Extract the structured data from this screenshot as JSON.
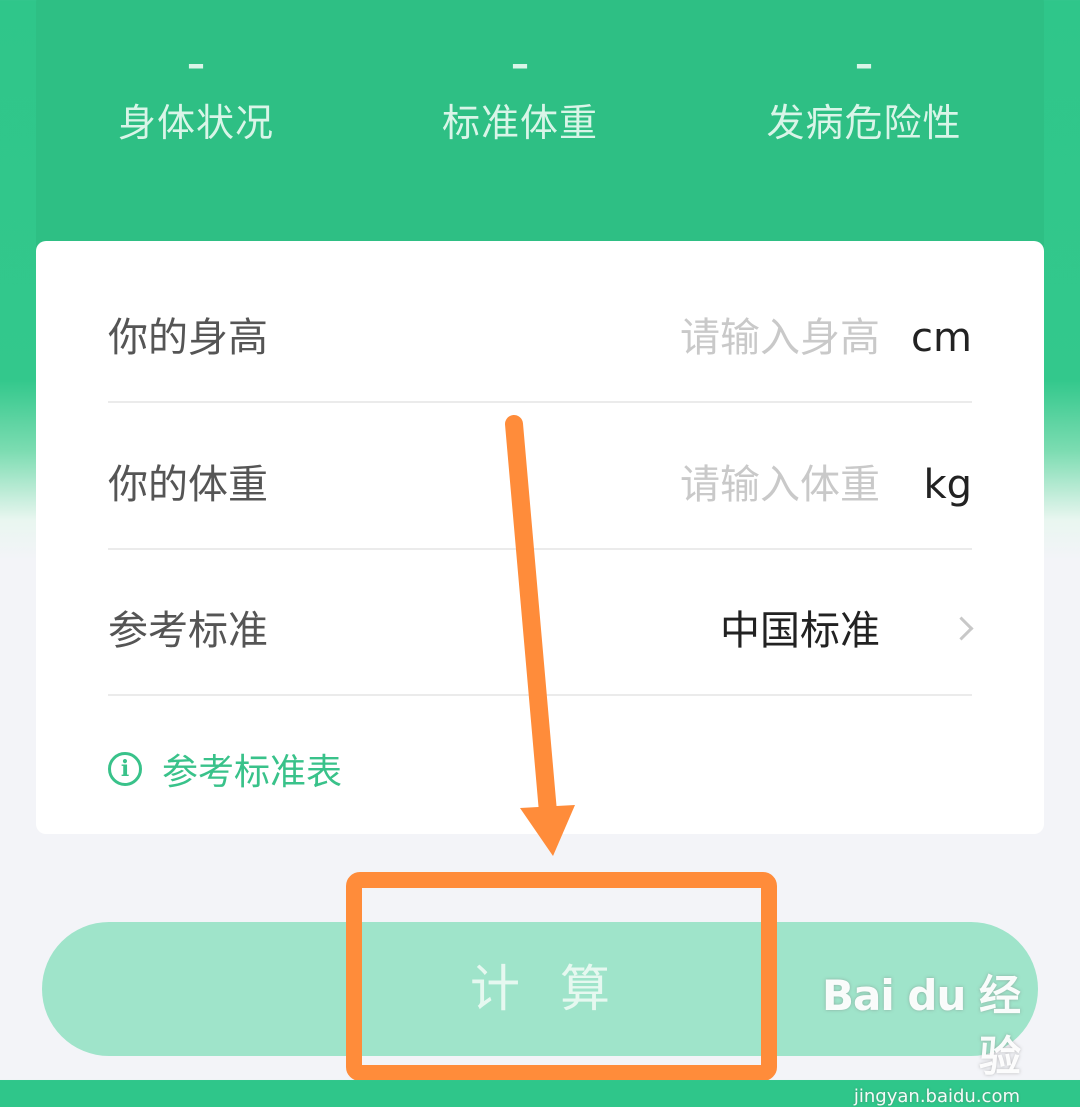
{
  "summary": {
    "stats": [
      {
        "value": "–",
        "label": "身体状况"
      },
      {
        "value": "–",
        "label": "标准体重"
      },
      {
        "value": "–",
        "label": "发病危险性"
      }
    ]
  },
  "form": {
    "height": {
      "label": "你的身高",
      "placeholder": "请输入身高",
      "unit": "cm"
    },
    "weight": {
      "label": "你的体重",
      "placeholder": "请输入体重",
      "unit": "kg"
    },
    "standard": {
      "label": "参考标准",
      "value": "中国标准"
    },
    "ref_link": "参考标准表"
  },
  "action": {
    "calculate_label": "计算"
  },
  "watermark": {
    "logo_text": "Bai du 经验",
    "url": "jingyan.baidu.com"
  },
  "colors": {
    "brand_green": "#2ebf84",
    "link_green": "#39c28a",
    "button_disabled": "#9fe4ca",
    "annotation_orange": "#ff8c3a"
  },
  "icons": {
    "info": "info-circle-icon",
    "chevron": "chevron-right-icon"
  }
}
